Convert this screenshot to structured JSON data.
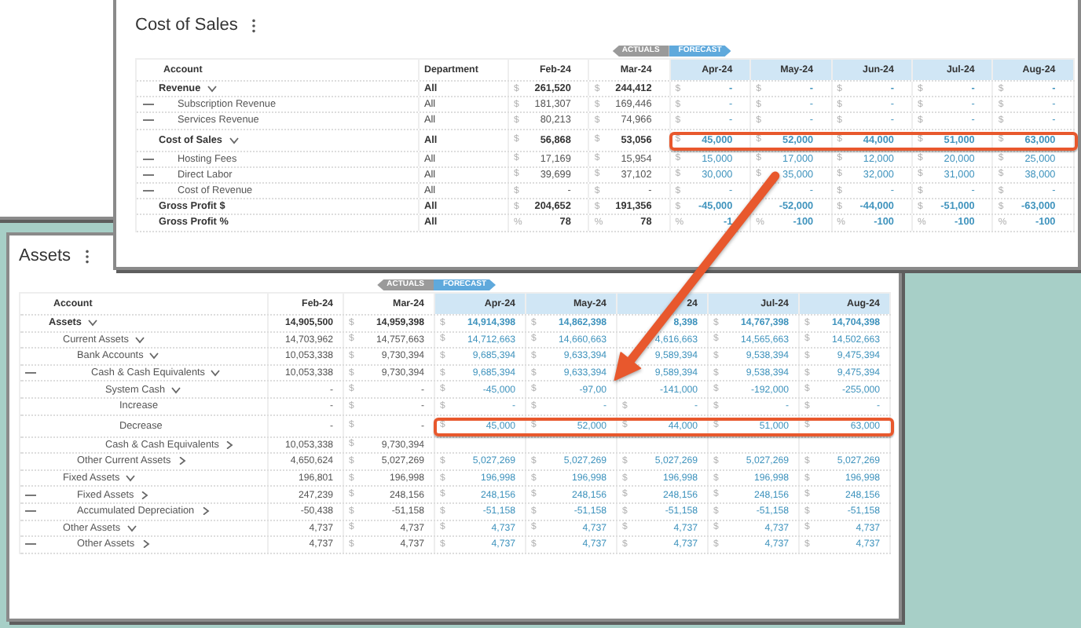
{
  "panels": [
    {
      "title": "Cost of Sales",
      "legend": [
        {
          "label": "ACTUALS",
          "kind": "actuals"
        },
        {
          "label": "FORECAST",
          "kind": "forecast"
        }
      ],
      "columns": [
        {
          "label": "Account",
          "kind": "account"
        },
        {
          "label": "Department",
          "kind": "department"
        },
        {
          "label": "Feb-24",
          "kind": "month",
          "forecast": false
        },
        {
          "label": "Mar-24",
          "kind": "month",
          "forecast": false
        },
        {
          "label": "Apr-24",
          "kind": "month",
          "forecast": true
        },
        {
          "label": "May-24",
          "kind": "month",
          "forecast": true
        },
        {
          "label": "Jun-24",
          "kind": "month",
          "forecast": true
        },
        {
          "label": "Jul-24",
          "kind": "month",
          "forecast": true
        },
        {
          "label": "Aug-24",
          "kind": "month",
          "forecast": true
        }
      ],
      "rows": [
        {
          "account": "Revenue",
          "bold": true,
          "handle": false,
          "highlighted": false,
          "expanded": true,
          "department": "All",
          "values": [
            {
              "unit": "$",
              "value": "261,520"
            },
            {
              "unit": "$",
              "value": "244,412"
            },
            {
              "unit": "$",
              "value": "-"
            },
            {
              "unit": "$",
              "value": "-"
            },
            {
              "unit": "$",
              "value": "-"
            },
            {
              "unit": "$",
              "value": "-"
            },
            {
              "unit": "$",
              "value": "-"
            }
          ],
          "children": [
            {
              "account": "Subscription Revenue",
              "bold": false,
              "handle": true,
              "highlighted": false,
              "department": "All",
              "values": [
                {
                  "unit": "$",
                  "value": "181,307"
                },
                {
                  "unit": "$",
                  "value": "169,446"
                },
                {
                  "unit": "$",
                  "value": "-"
                },
                {
                  "unit": "$",
                  "value": "-"
                },
                {
                  "unit": "$",
                  "value": "-"
                },
                {
                  "unit": "$",
                  "value": "-"
                },
                {
                  "unit": "$",
                  "value": "-"
                }
              ]
            },
            {
              "account": "Services Revenue",
              "bold": false,
              "handle": true,
              "highlighted": false,
              "department": "All",
              "values": [
                {
                  "unit": "$",
                  "value": "80,213"
                },
                {
                  "unit": "$",
                  "value": "74,966"
                },
                {
                  "unit": "$",
                  "value": "-"
                },
                {
                  "unit": "$",
                  "value": "-"
                },
                {
                  "unit": "$",
                  "value": "-"
                },
                {
                  "unit": "$",
                  "value": "-"
                },
                {
                  "unit": "$",
                  "value": "-"
                }
              ]
            }
          ]
        },
        {
          "account": "Cost of Sales",
          "bold": true,
          "handle": false,
          "highlighted": true,
          "expanded": true,
          "department": "All",
          "values": [
            {
              "unit": "$",
              "value": "56,868"
            },
            {
              "unit": "$",
              "value": "53,056"
            },
            {
              "unit": "$",
              "value": "45,000"
            },
            {
              "unit": "$",
              "value": "52,000"
            },
            {
              "unit": "$",
              "value": "44,000"
            },
            {
              "unit": "$",
              "value": "51,000"
            },
            {
              "unit": "$",
              "value": "63,000"
            }
          ],
          "children": [
            {
              "account": "Hosting Fees",
              "bold": false,
              "handle": true,
              "highlighted": false,
              "department": "All",
              "values": [
                {
                  "unit": "$",
                  "value": "17,169"
                },
                {
                  "unit": "$",
                  "value": "15,954"
                },
                {
                  "unit": "$",
                  "value": "15,000"
                },
                {
                  "unit": "$",
                  "value": "17,000"
                },
                {
                  "unit": "$",
                  "value": "12,000"
                },
                {
                  "unit": "$",
                  "value": "20,000"
                },
                {
                  "unit": "$",
                  "value": "25,000"
                }
              ]
            },
            {
              "account": "Direct Labor",
              "bold": false,
              "handle": true,
              "highlighted": false,
              "department": "All",
              "values": [
                {
                  "unit": "$",
                  "value": "39,699"
                },
                {
                  "unit": "$",
                  "value": "37,102"
                },
                {
                  "unit": "$",
                  "value": "30,000"
                },
                {
                  "unit": "$",
                  "value": "35,000"
                },
                {
                  "unit": "$",
                  "value": "32,000"
                },
                {
                  "unit": "$",
                  "value": "31,000"
                },
                {
                  "unit": "$",
                  "value": "38,000"
                }
              ]
            },
            {
              "account": "Cost of Revenue",
              "bold": false,
              "handle": true,
              "highlighted": false,
              "department": "All",
              "values": [
                {
                  "unit": "$",
                  "value": "-"
                },
                {
                  "unit": "$",
                  "value": "-"
                },
                {
                  "unit": "$",
                  "value": "-"
                },
                {
                  "value": "-"
                },
                {
                  "unit": "$",
                  "value": "-"
                },
                {
                  "unit": "$",
                  "value": "-"
                },
                {
                  "unit": "$",
                  "value": "-"
                }
              ]
            }
          ]
        },
        {
          "account": "Gross Profit $",
          "bold": true,
          "handle": false,
          "highlighted": false,
          "department": "All",
          "values": [
            {
              "unit": "$",
              "value": "204,652"
            },
            {
              "unit": "$",
              "value": "191,356"
            },
            {
              "unit": "$",
              "value": "-45,000"
            },
            {
              "value": "-52,000"
            },
            {
              "unit": "$",
              "value": "-44,000"
            },
            {
              "unit": "$",
              "value": "-51,000"
            },
            {
              "unit": "$",
              "value": "-63,000"
            }
          ]
        },
        {
          "account": "Gross Profit %",
          "bold": true,
          "handle": false,
          "highlighted": false,
          "department": "All",
          "values": [
            {
              "unit": "%",
              "value": "78"
            },
            {
              "unit": "%",
              "value": "78"
            },
            {
              "unit": "%",
              "value": "-1"
            },
            {
              "unit": "%",
              "value": "-100"
            },
            {
              "unit": "%",
              "value": "-100"
            },
            {
              "unit": "%",
              "value": "-100"
            },
            {
              "unit": "%",
              "value": "-100"
            }
          ]
        }
      ]
    },
    {
      "title": "Assets",
      "legend": [
        {
          "label": "ACTUALS",
          "kind": "actuals"
        },
        {
          "label": "FORECAST",
          "kind": "forecast"
        }
      ],
      "columns": [
        {
          "label": "Account",
          "kind": "account"
        },
        {
          "label": "Feb-24",
          "kind": "month",
          "forecast": false
        },
        {
          "label": "Mar-24",
          "kind": "month",
          "forecast": false
        },
        {
          "label": "Apr-24",
          "kind": "month",
          "forecast": true
        },
        {
          "label": "May-24",
          "kind": "month",
          "forecast": true
        },
        {
          "label": "24",
          "kind": "month",
          "forecast": true
        },
        {
          "label": "Jul-24",
          "kind": "month",
          "forecast": true
        },
        {
          "label": "Aug-24",
          "kind": "month",
          "forecast": true
        }
      ],
      "rows": [
        {
          "account": "Assets",
          "bold": true,
          "handle": false,
          "highlighted": false,
          "expanded": true,
          "values": [
            {
              "value": "14,905,500"
            },
            {
              "unit": "$",
              "value": "14,959,398"
            },
            {
              "unit": "$",
              "value": "14,914,398"
            },
            {
              "unit": "$",
              "value": "14,862,398"
            },
            {
              "value": "8,398"
            },
            {
              "unit": "$",
              "value": "14,767,398"
            },
            {
              "unit": "$",
              "value": "14,704,398"
            }
          ],
          "children": [
            {
              "account": "Current Assets",
              "bold": false,
              "handle": false,
              "highlighted": false,
              "expanded": true,
              "values": [
                {
                  "value": "14,703,962"
                },
                {
                  "unit": "$",
                  "value": "14,757,663"
                },
                {
                  "unit": "$",
                  "value": "14,712,663"
                },
                {
                  "unit": "$",
                  "value": "14,660,663"
                },
                {
                  "value": "4,616,663"
                },
                {
                  "unit": "$",
                  "value": "14,565,663"
                },
                {
                  "unit": "$",
                  "value": "14,502,663"
                }
              ],
              "children": [
                {
                  "account": "Bank Accounts",
                  "bold": false,
                  "handle": false,
                  "highlighted": false,
                  "expanded": true,
                  "values": [
                    {
                      "value": "10,053,338"
                    },
                    {
                      "unit": "$",
                      "value": "9,730,394"
                    },
                    {
                      "unit": "$",
                      "value": "9,685,394"
                    },
                    {
                      "unit": "$",
                      "value": "9,633,394"
                    },
                    {
                      "value": "9,589,394"
                    },
                    {
                      "unit": "$",
                      "value": "9,538,394"
                    },
                    {
                      "unit": "$",
                      "value": "9,475,394"
                    }
                  ],
                  "children": [
                    {
                      "account": "Cash & Cash Equivalents",
                      "bold": false,
                      "handle": true,
                      "highlighted": false,
                      "expanded": true,
                      "values": [
                        {
                          "value": "10,053,338"
                        },
                        {
                          "unit": "$",
                          "value": "9,730,394"
                        },
                        {
                          "unit": "$",
                          "value": "9,685,394"
                        },
                        {
                          "unit": "$",
                          "value": "9,633,394"
                        },
                        {
                          "value": "9,589,394"
                        },
                        {
                          "unit": "$",
                          "value": "9,538,394"
                        },
                        {
                          "unit": "$",
                          "value": "9,475,394"
                        }
                      ],
                      "children": [
                        {
                          "account": "System Cash",
                          "bold": false,
                          "handle": false,
                          "highlighted": false,
                          "expanded": true,
                          "values": [
                            {
                              "value": "-"
                            },
                            {
                              "unit": "$",
                              "value": "-"
                            },
                            {
                              "unit": "$",
                              "value": "-45,000"
                            },
                            {
                              "unit": "$",
                              "value": "-97,00"
                            },
                            {
                              "value": "-141,000"
                            },
                            {
                              "unit": "$",
                              "value": "-192,000"
                            },
                            {
                              "unit": "$",
                              "value": "-255,000"
                            }
                          ],
                          "children": [
                            {
                              "account": "Increase",
                              "bold": false,
                              "handle": false,
                              "highlighted": false,
                              "values": [
                                {
                                  "value": "-"
                                },
                                {
                                  "unit": "$",
                                  "value": "-"
                                },
                                {
                                  "unit": "$",
                                  "value": "-"
                                },
                                {
                                  "unit": "$",
                                  "value": "-"
                                },
                                {
                                  "unit": "$",
                                  "value": "-"
                                },
                                {
                                  "unit": "$",
                                  "value": "-"
                                },
                                {
                                  "unit": "$",
                                  "value": "-"
                                }
                              ]
                            },
                            {
                              "account": "Decrease",
                              "bold": false,
                              "handle": false,
                              "highlighted": true,
                              "values": [
                                {
                                  "value": "-"
                                },
                                {
                                  "unit": "$",
                                  "value": "-"
                                },
                                {
                                  "unit": "$",
                                  "value": "45,000"
                                },
                                {
                                  "unit": "$",
                                  "value": "52,000"
                                },
                                {
                                  "unit": "$",
                                  "value": "44,000"
                                },
                                {
                                  "unit": "$",
                                  "value": "51,000"
                                },
                                {
                                  "unit": "$",
                                  "value": "63,000"
                                }
                              ]
                            }
                          ]
                        },
                        {
                          "account": "Cash & Cash Equivalents",
                          "bold": false,
                          "handle": false,
                          "highlighted": false,
                          "expanded": false,
                          "values": [
                            {
                              "value": "10,053,338"
                            },
                            {
                              "unit": "$",
                              "value": "9,730,394"
                            }
                          ]
                        }
                      ]
                    }
                  ]
                },
                {
                  "account": "Other Current Assets",
                  "bold": false,
                  "handle": false,
                  "highlighted": false,
                  "expanded": false,
                  "values": [
                    {
                      "value": "4,650,624"
                    },
                    {
                      "unit": "$",
                      "value": "5,027,269"
                    },
                    {
                      "unit": "$",
                      "value": "5,027,269"
                    },
                    {
                      "unit": "$",
                      "value": "5,027,269"
                    },
                    {
                      "unit": "$",
                      "value": "5,027,269"
                    },
                    {
                      "unit": "$",
                      "value": "5,027,269"
                    },
                    {
                      "unit": "$",
                      "value": "5,027,269"
                    }
                  ]
                }
              ]
            },
            {
              "account": "Fixed Assets",
              "bold": false,
              "handle": false,
              "highlighted": false,
              "expanded": true,
              "values": [
                {
                  "value": "196,801"
                },
                {
                  "unit": "$",
                  "value": "196,998"
                },
                {
                  "unit": "$",
                  "value": "196,998"
                },
                {
                  "unit": "$",
                  "value": "196,998"
                },
                {
                  "unit": "$",
                  "value": "196,998"
                },
                {
                  "unit": "$",
                  "value": "196,998"
                },
                {
                  "unit": "$",
                  "value": "196,998"
                }
              ],
              "children": [
                {
                  "account": "Fixed Assets",
                  "bold": false,
                  "handle": true,
                  "highlighted": false,
                  "expanded": false,
                  "values": [
                    {
                      "value": "247,239"
                    },
                    {
                      "unit": "$",
                      "value": "248,156"
                    },
                    {
                      "unit": "$",
                      "value": "248,156"
                    },
                    {
                      "unit": "$",
                      "value": "248,156"
                    },
                    {
                      "unit": "$",
                      "value": "248,156"
                    },
                    {
                      "unit": "$",
                      "value": "248,156"
                    },
                    {
                      "unit": "$",
                      "value": "248,156"
                    }
                  ]
                },
                {
                  "account": "Accumulated Depreciation",
                  "bold": false,
                  "handle": true,
                  "highlighted": false,
                  "expanded": false,
                  "values": [
                    {
                      "value": "-50,438"
                    },
                    {
                      "unit": "$",
                      "value": "-51,158"
                    },
                    {
                      "unit": "$",
                      "value": "-51,158"
                    },
                    {
                      "unit": "$",
                      "value": "-51,158"
                    },
                    {
                      "unit": "$",
                      "value": "-51,158"
                    },
                    {
                      "unit": "$",
                      "value": "-51,158"
                    },
                    {
                      "unit": "$",
                      "value": "-51,158"
                    }
                  ]
                }
              ]
            },
            {
              "account": "Other Assets",
              "bold": false,
              "handle": false,
              "highlighted": false,
              "expanded": true,
              "values": [
                {
                  "value": "4,737"
                },
                {
                  "unit": "$",
                  "value": "4,737"
                },
                {
                  "unit": "$",
                  "value": "4,737"
                },
                {
                  "unit": "$",
                  "value": "4,737"
                },
                {
                  "unit": "$",
                  "value": "4,737"
                },
                {
                  "unit": "$",
                  "value": "4,737"
                },
                {
                  "unit": "$",
                  "value": "4,737"
                }
              ],
              "children": [
                {
                  "account": "Other Assets",
                  "bold": false,
                  "handle": true,
                  "highlighted": false,
                  "expanded": false,
                  "values": [
                    {
                      "value": "4,737"
                    },
                    {
                      "unit": "$",
                      "value": "4,737"
                    },
                    {
                      "unit": "$",
                      "value": "4,737"
                    },
                    {
                      "unit": "$",
                      "value": "4,737"
                    },
                    {
                      "unit": "$",
                      "value": "4,737"
                    },
                    {
                      "unit": "$",
                      "value": "4,737"
                    },
                    {
                      "unit": "$",
                      "value": "4,737"
                    }
                  ]
                }
              ]
            }
          ]
        }
      ]
    }
  ]
}
